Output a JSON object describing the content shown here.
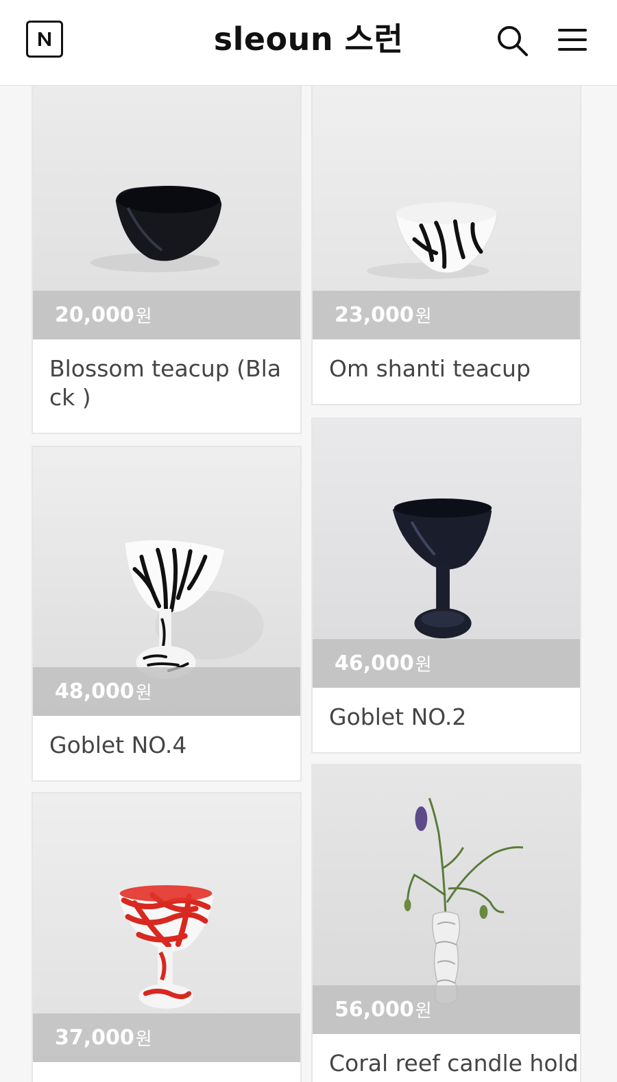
{
  "header": {
    "logo_letter": "N",
    "title": "sleoun 스런",
    "search_icon": "search-icon",
    "menu_icon": "hamburger-menu-icon"
  },
  "products": [
    {
      "price": "20,000",
      "unit": "원",
      "name": "Blossom teacup (Black )"
    },
    {
      "price": "23,000",
      "unit": "원",
      "name": "Om shanti teacup"
    },
    {
      "price": "48,000",
      "unit": "원",
      "name": "Goblet NO.4"
    },
    {
      "price": "46,000",
      "unit": "원",
      "name": "Goblet NO.2"
    },
    {
      "price": "37,000",
      "unit": "원",
      "name": ""
    },
    {
      "price": "56,000",
      "unit": "원",
      "name": "Coral reef candle hold"
    }
  ],
  "colors": {
    "header_bg": "#ffffff",
    "price_overlay": "#bebebe",
    "text": "#444444"
  }
}
